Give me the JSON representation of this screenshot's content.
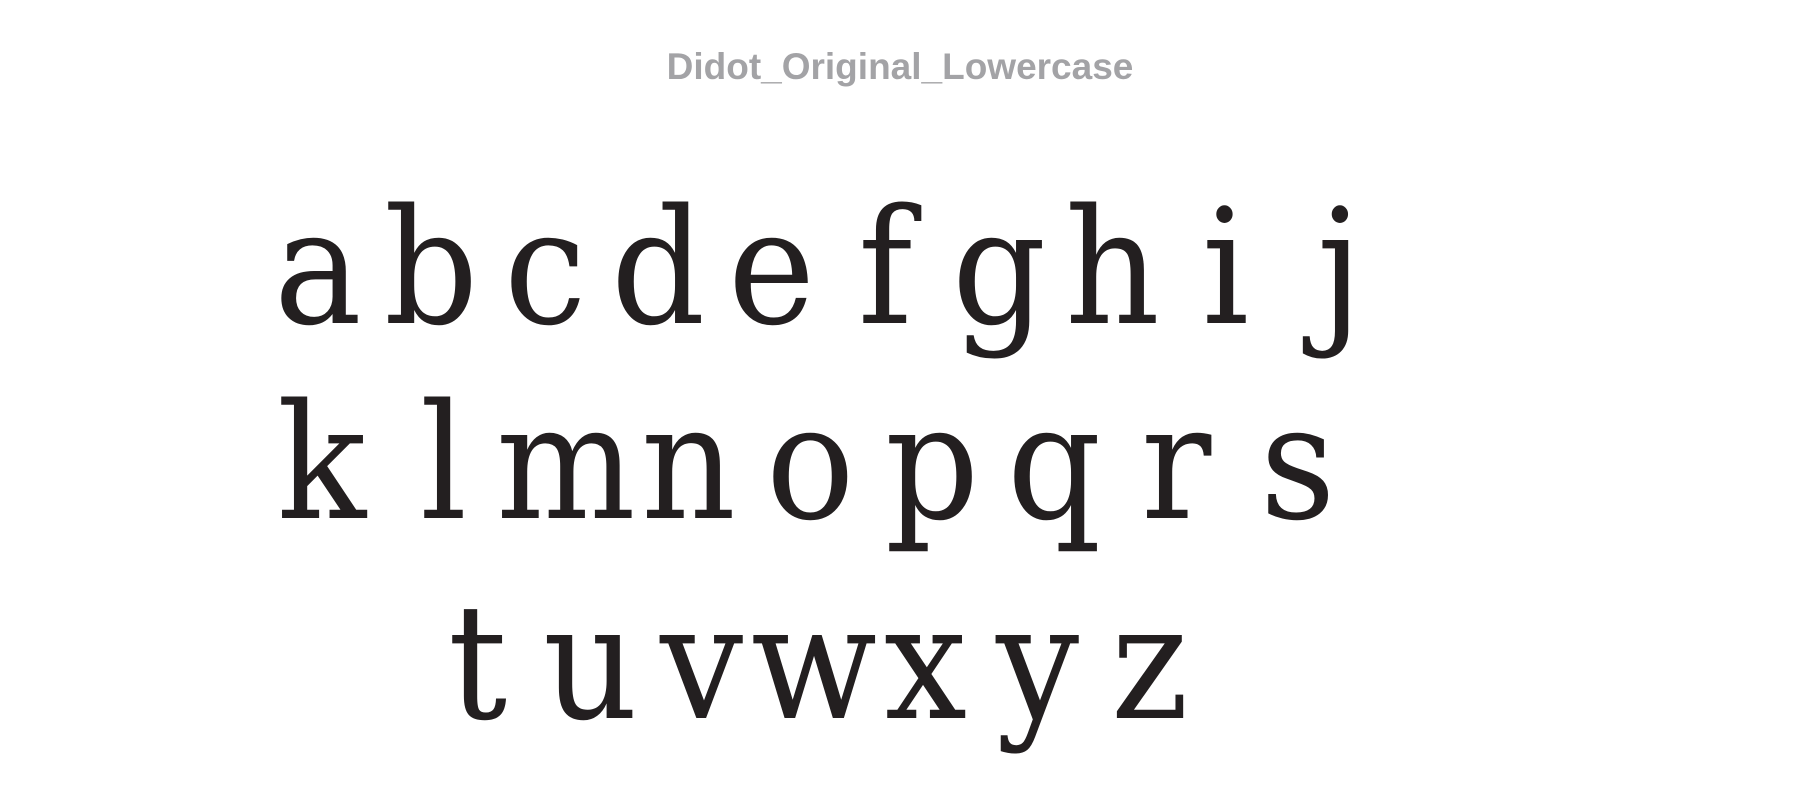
{
  "title": "Didot_Original_Lowercase",
  "rows": [
    [
      "a",
      "b",
      "c",
      "d",
      "e",
      "f",
      "g",
      "h",
      "i",
      "j"
    ],
    [
      "k",
      "l",
      "m",
      "n",
      "o",
      "p",
      "q",
      "r",
      "s"
    ],
    [
      "t",
      "u",
      "v",
      "w",
      "x",
      "y",
      "z"
    ]
  ],
  "colors": {
    "title": "#a3a3a6",
    "glyph": "#231f20",
    "background": "#ffffff"
  }
}
